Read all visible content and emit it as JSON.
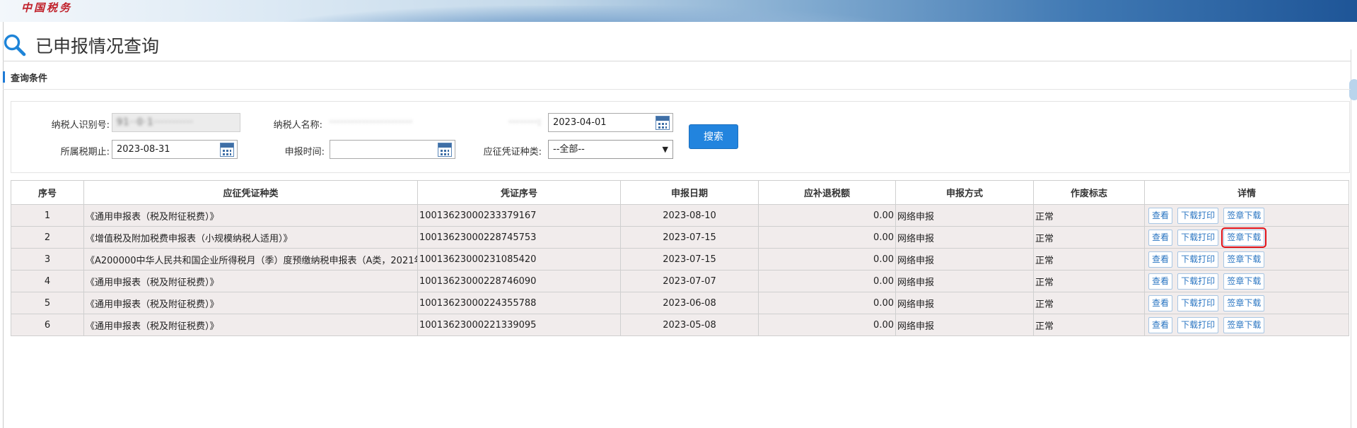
{
  "banner": {
    "logo_text": "中国税务"
  },
  "page": {
    "title": "已申报情况查询",
    "icon": "search-icon"
  },
  "section": {
    "query_conditions_label": "查询条件"
  },
  "form": {
    "taxpayer_id_label": "纳税人识别号:",
    "taxpayer_id_value": "91··0·1···········",
    "taxpayer_name_label": "纳税人名称:",
    "taxpayer_name_value": "·······················",
    "period_start_label": "········:",
    "period_start_value": "2023-04-01",
    "period_end_label": "所属税期止:",
    "period_end_value": "2023-08-31",
    "declare_time_label": "申报时间:",
    "declare_time_value": "",
    "voucher_type_label": "应征凭证种类:",
    "voucher_type_value": "--全部--",
    "search_button": "搜索"
  },
  "table": {
    "headers": [
      "序号",
      "应征凭证种类",
      "凭证序号",
      "申报日期",
      "应补退税额",
      "申报方式",
      "作废标志",
      "详情"
    ],
    "action_labels": {
      "view": "查看",
      "print": "下载打印",
      "sign": "签章下载"
    },
    "rows": [
      {
        "no": "1",
        "type": "《通用申报表（税及附征税费）》",
        "voucher": "10013623000233379167",
        "date": "2023-08-10",
        "amount": "0.00",
        "method": "网络申报",
        "void": "正常"
      },
      {
        "no": "2",
        "type": "《增值税及附加税费申报表（小规模纳税人适用）》",
        "voucher": "10013623000228745753",
        "date": "2023-07-15",
        "amount": "0.00",
        "method": "网络申报",
        "void": "正常"
      },
      {
        "no": "3",
        "type": "《A200000中华人民共和国企业所得税月（季）度预缴纳税申报表（A类，2021年",
        "voucher": "10013623000231085420",
        "date": "2023-07-15",
        "amount": "0.00",
        "method": "网络申报",
        "void": "正常"
      },
      {
        "no": "4",
        "type": "《通用申报表（税及附征税费）》",
        "voucher": "10013623000228746090",
        "date": "2023-07-07",
        "amount": "0.00",
        "method": "网络申报",
        "void": "正常"
      },
      {
        "no": "5",
        "type": "《通用申报表（税及附征税费）》",
        "voucher": "10013623000224355788",
        "date": "2023-06-08",
        "amount": "0.00",
        "method": "网络申报",
        "void": "正常"
      },
      {
        "no": "6",
        "type": "《通用申报表（税及附征税费）》",
        "voucher": "10013623000221339095",
        "date": "2023-05-08",
        "amount": "0.00",
        "method": "网络申报",
        "void": "正常"
      }
    ]
  },
  "colors": {
    "accent": "#2284de",
    "highlight": "#e0131a",
    "row_bg": "#f1ecec"
  }
}
